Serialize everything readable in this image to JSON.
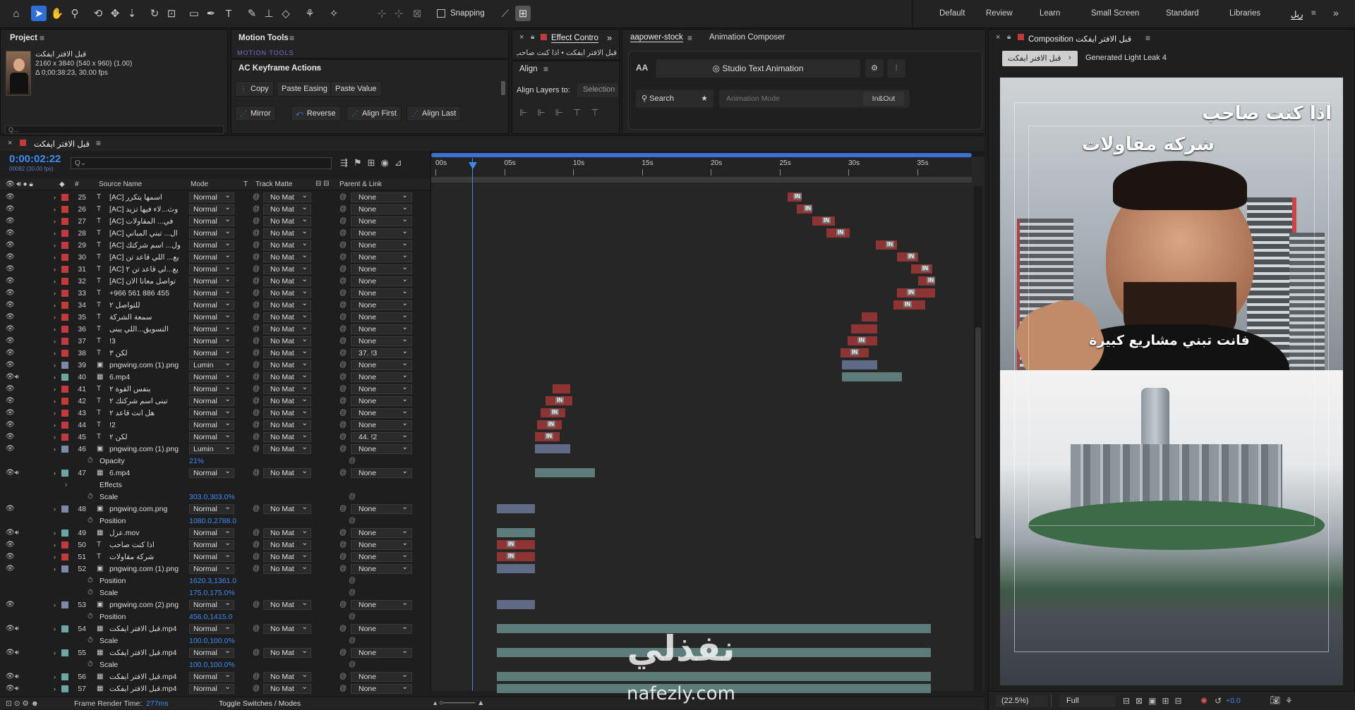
{
  "toolbar": {
    "snapping": "Snapping",
    "workspaces": [
      "Default",
      "Review",
      "Learn",
      "Small Screen",
      "Standard",
      "Libraries",
      "ريل"
    ]
  },
  "project": {
    "title": "Project",
    "file_name": "قبل الافتر ايفكت",
    "dims": "2160 x 3840  (540 x 960) (1.00)",
    "duration": "Δ 0;00:38:23, 30.00 fps",
    "search_placeholder": "Q..."
  },
  "motion_tools": {
    "title": "Motion Tools",
    "sub": "MOTION TOOLS"
  },
  "keyframe_actions": {
    "title": "AC Keyframe Actions",
    "buttons": [
      "Copy",
      "Paste Easing",
      "Paste Value",
      "Mirror",
      "Reverse",
      "Align First",
      "Align Last"
    ]
  },
  "effect_controls": {
    "title": "Effect Contro",
    "path": "قبل الافتر ايفكت • اذا كنت صاحب"
  },
  "align": {
    "title": "Align",
    "label": "Align Layers to:",
    "value": "Selection"
  },
  "aapower": {
    "tab1": "aapower-stock",
    "tab2": "Animation Composer",
    "studio": "Studio Text Animation",
    "aa": "AA",
    "search": "Search",
    "mode": "Animation Mode",
    "inout": "In&Out"
  },
  "composition": {
    "title": "Composition",
    "name": "قبل الافتر ايفكت",
    "crumb1": "قبل الافتر ايفكت",
    "crumb2": "Generated Light Leak 4",
    "overlay1": "اذا كنت صاحب",
    "overlay2": "شركة مقاولات",
    "subtitle": "فانت تبني مشاريع كبيرة",
    "zoom": "(22.5%)",
    "res": "Full",
    "exposure": "+0.0"
  },
  "timeline": {
    "comp_tab": "قبل الافتر ايفكت",
    "timecode": "0:00:02:22",
    "frame_info": "00082 (30.00 fps)",
    "search_placeholder": "Q⌄",
    "headers": {
      "source": "Source Name",
      "mode": "Mode",
      "t": "T",
      "track": "Track Matte",
      "parent": "Parent & Link",
      "num": "#"
    },
    "ruler": [
      "00s",
      "05s",
      "10s",
      "15s",
      "20s",
      "25s",
      "30s",
      "35s"
    ],
    "rows": [
      {
        "num": "25",
        "type": "T",
        "name": "[AC] اسمها يتكرر",
        "mode": "Normal",
        "tm": "No Mat",
        "parent": "None",
        "color": "#c23a3a"
      },
      {
        "num": "26",
        "type": "T",
        "name": "[AC] وث...لاء فيها تزيد",
        "mode": "Normal",
        "tm": "No Mat",
        "parent": "None",
        "color": "#c23a3a"
      },
      {
        "num": "27",
        "type": "T",
        "name": "[AC] في... المقاولات",
        "mode": "Normal",
        "tm": "No Mat",
        "parent": "None",
        "color": "#c23a3a"
      },
      {
        "num": "28",
        "type": "T",
        "name": "[AC] ال... تبني المباني",
        "mode": "Normal",
        "tm": "No Mat",
        "parent": "None",
        "color": "#c23a3a"
      },
      {
        "num": "29",
        "type": "T",
        "name": "[AC] ول... اسم شركتك",
        "mode": "Normal",
        "tm": "No Mat",
        "parent": "None",
        "color": "#c23a3a"
      },
      {
        "num": "30",
        "type": "T",
        "name": "[AC] يع... اللي قاعد تن",
        "mode": "Normal",
        "tm": "No Mat",
        "parent": "None",
        "color": "#c23a3a"
      },
      {
        "num": "31",
        "type": "T",
        "name": "[AC] يع...لي قاعد تن ٢",
        "mode": "Normal",
        "tm": "No Mat",
        "parent": "None",
        "color": "#c23a3a"
      },
      {
        "num": "32",
        "type": "T",
        "name": "[AC] تواصل معانا الان",
        "mode": "Normal",
        "tm": "No Mat",
        "parent": "None",
        "color": "#c23a3a"
      },
      {
        "num": "33",
        "type": "T",
        "name": "+966 561 886 455",
        "mode": "Normal",
        "tm": "No Mat",
        "parent": "None",
        "color": "#c23a3a"
      },
      {
        "num": "34",
        "type": "T",
        "name": "للتواصل ٢",
        "mode": "Normal",
        "tm": "No Mat",
        "parent": "None",
        "color": "#c23a3a"
      },
      {
        "num": "35",
        "type": "T",
        "name": "سمعة الشركة",
        "mode": "Normal",
        "tm": "No Mat",
        "parent": "None",
        "color": "#c23a3a"
      },
      {
        "num": "36",
        "type": "T",
        "name": "التسويق...اللي يبنى",
        "mode": "Normal",
        "tm": "No Mat",
        "parent": "None",
        "color": "#c23a3a"
      },
      {
        "num": "37",
        "type": "T",
        "name": "!3",
        "mode": "Normal",
        "tm": "No Mat",
        "parent": "None",
        "color": "#c23a3a"
      },
      {
        "num": "38",
        "type": "T",
        "name": "لكن ٣",
        "mode": "Normal",
        "tm": "No Mat",
        "parent": "37. !3",
        "color": "#c23a3a"
      },
      {
        "num": "39",
        "type": "img",
        "name": "pngwing.com (1).png",
        "mode": "Lumin",
        "tm": "No Mat",
        "parent": "None",
        "color": "#7c8aa8"
      },
      {
        "num": "40",
        "type": "vid",
        "name": "6.mp4",
        "mode": "Normal",
        "tm": "No Mat",
        "parent": "None",
        "color": "#6aa7a0"
      },
      {
        "num": "41",
        "type": "T",
        "name": "بنفس القوة ٢",
        "mode": "Normal",
        "tm": "No Mat",
        "parent": "None",
        "color": "#c23a3a"
      },
      {
        "num": "42",
        "type": "T",
        "name": "تبنى اسم شركتك ٢",
        "mode": "Normal",
        "tm": "No Mat",
        "parent": "None",
        "color": "#c23a3a"
      },
      {
        "num": "43",
        "type": "T",
        "name": "هل انت قاعد ٢",
        "mode": "Normal",
        "tm": "No Mat",
        "parent": "None",
        "color": "#c23a3a"
      },
      {
        "num": "44",
        "type": "T",
        "name": "!2",
        "mode": "Normal",
        "tm": "No Mat",
        "parent": "None",
        "color": "#c23a3a"
      },
      {
        "num": "45",
        "type": "T",
        "name": "لكن ٢",
        "mode": "Normal",
        "tm": "No Mat",
        "parent": "44. !2",
        "color": "#c23a3a"
      },
      {
        "num": "46",
        "type": "img",
        "name": "pngwing.com (1).png",
        "mode": "Lumin",
        "tm": "No Mat",
        "parent": "None",
        "color": "#7c8aa8"
      },
      {
        "prop": true,
        "name": "Opacity",
        "value": "21%"
      },
      {
        "num": "47",
        "type": "vid",
        "name": "6.mp4",
        "mode": "Normal",
        "tm": "No Mat",
        "parent": "None",
        "color": "#6aa7a0"
      },
      {
        "prop": true,
        "group": true,
        "name": "Effects",
        "value": ""
      },
      {
        "prop": true,
        "name": "Scale",
        "value": "303.0,303.0%"
      },
      {
        "num": "48",
        "type": "img",
        "name": "pngwing.com.png",
        "mode": "Normal",
        "tm": "No Mat",
        "parent": "None",
        "color": "#7c8aa8"
      },
      {
        "prop": true,
        "name": "Position",
        "value": "1080.0,2788.0"
      },
      {
        "num": "49",
        "type": "vid",
        "name": "عزل.mov",
        "mode": "Normal",
        "tm": "No Mat",
        "parent": "None",
        "color": "#6aa7a0"
      },
      {
        "num": "50",
        "type": "T",
        "name": "اذا كنت صاحب",
        "mode": "Normal",
        "tm": "No Mat",
        "parent": "None",
        "color": "#c23a3a"
      },
      {
        "num": "51",
        "type": "T",
        "name": "شركة مقاولات",
        "mode": "Normal",
        "tm": "No Mat",
        "parent": "None",
        "color": "#c23a3a"
      },
      {
        "num": "52",
        "type": "img",
        "name": "pngwing.com (1).png",
        "mode": "Normal",
        "tm": "No Mat",
        "parent": "None",
        "color": "#7c8aa8"
      },
      {
        "prop": true,
        "name": "Position",
        "value": "1620.3,1361.0"
      },
      {
        "prop": true,
        "name": "Scale",
        "value": "175.0,175.0%"
      },
      {
        "num": "53",
        "type": "img",
        "name": "pngwing.com (2).png",
        "mode": "Normal",
        "tm": "No Mat",
        "parent": "None",
        "color": "#7c8aa8"
      },
      {
        "prop": true,
        "name": "Position",
        "value": "456.0,1415.0"
      },
      {
        "num": "54",
        "type": "vid",
        "name": "قبل الافتر ايفكت.mp4",
        "mode": "Normal",
        "tm": "No Mat",
        "parent": "None",
        "color": "#6aa7a0"
      },
      {
        "prop": true,
        "name": "Scale",
        "value": "100.0,100.0%"
      },
      {
        "num": "55",
        "type": "vid",
        "name": "قبل الافتر ايفكت.mp4",
        "mode": "Normal",
        "tm": "No Mat",
        "parent": "None",
        "color": "#6aa7a0"
      },
      {
        "prop": true,
        "name": "Scale",
        "value": "100.0,100.0%"
      },
      {
        "num": "56",
        "type": "vid",
        "name": "قبل الافتر ايفكت.mp4",
        "mode": "Normal",
        "tm": "No Mat",
        "parent": "None",
        "color": "#6aa7a0"
      },
      {
        "num": "57",
        "type": "vid",
        "name": "قبل الافتر ايفكت.mp4",
        "mode": "Normal",
        "tm": "No Mat",
        "parent": "None",
        "color": "#6aa7a0"
      }
    ],
    "footer": {
      "render": "Frame Render Time:",
      "render_val": "277ms",
      "toggle": "Toggle Switches / Modes"
    }
  },
  "watermark": {
    "arabic": "نفذلي",
    "latin": "nafezly.com"
  }
}
